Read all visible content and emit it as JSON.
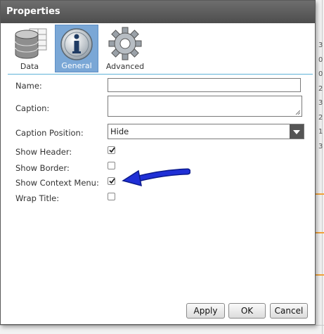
{
  "dialog": {
    "title": "Properties"
  },
  "toolbar": {
    "tabs": [
      {
        "label": "Data",
        "icon": "database-icon",
        "selected": false
      },
      {
        "label": "General",
        "icon": "info-icon",
        "selected": true
      },
      {
        "label": "Advanced",
        "icon": "gear-icon",
        "selected": false
      }
    ]
  },
  "form": {
    "name_label": "Name:",
    "name_value": "",
    "caption_label": "Caption:",
    "caption_value": "",
    "caption_position_label": "Caption Position:",
    "caption_position_value": "Hide",
    "show_header_label": "Show Header:",
    "show_header_checked": true,
    "show_border_label": "Show Border:",
    "show_border_checked": false,
    "show_context_menu_label": "Show Context Menu:",
    "show_context_menu_checked": true,
    "wrap_title_label": "Wrap Title:",
    "wrap_title_checked": false
  },
  "buttons": {
    "apply": "Apply",
    "ok": "OK",
    "cancel": "Cancel"
  },
  "colors": {
    "selected_tab": "#7aa7d6",
    "separator": "#5fb3d8",
    "annotation_arrow": "#1f2fd6",
    "title_bar": "#5a5a5a"
  },
  "background_digits": [
    "3",
    "0",
    "0",
    "2",
    "3",
    "2",
    "1",
    "3"
  ]
}
